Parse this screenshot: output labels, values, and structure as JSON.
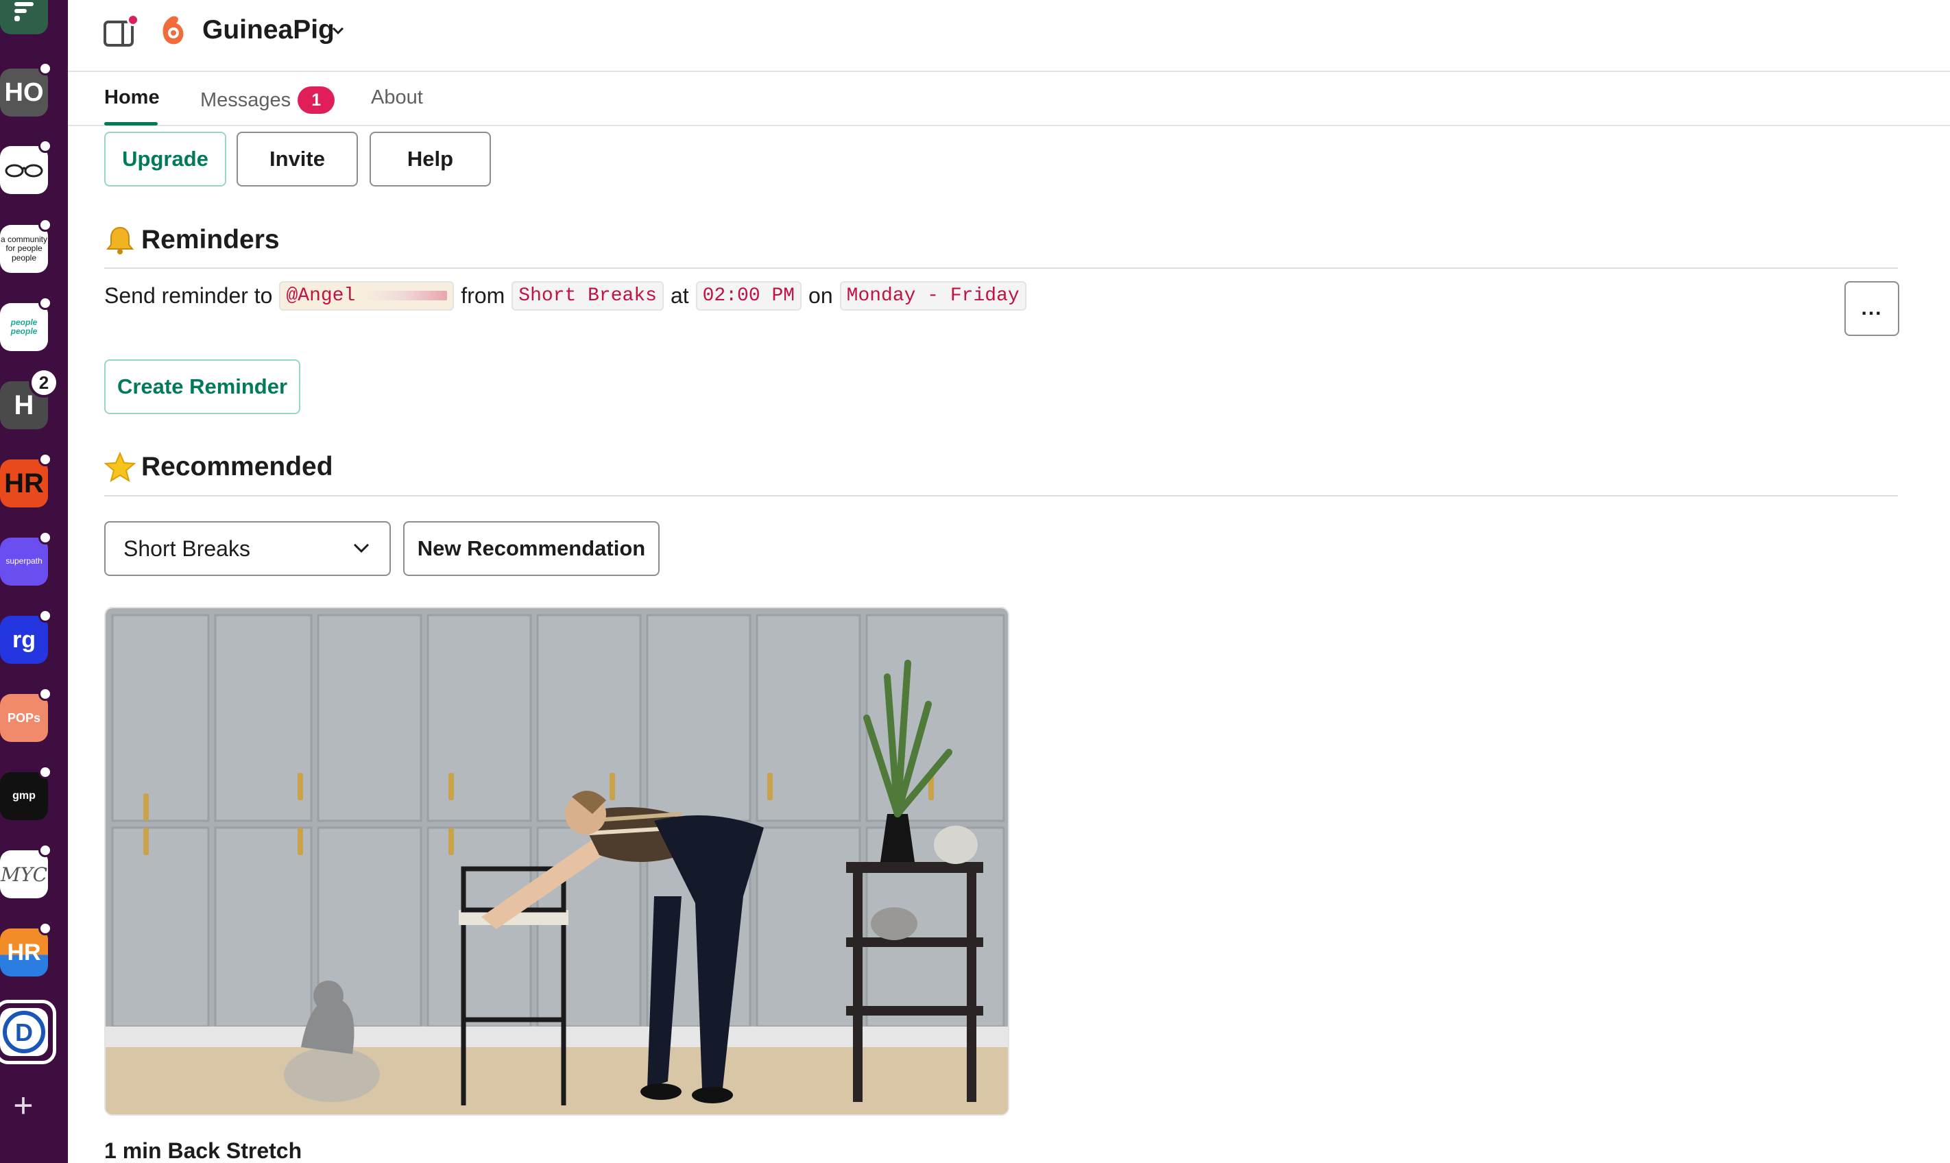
{
  "app": {
    "name": "GuineaPig"
  },
  "workspaces": {
    "items": [
      {
        "label": "",
        "bg": "#2e5f48"
      },
      {
        "label": "HO",
        "bg": "#555555"
      },
      {
        "label": "",
        "bg": "#ffffff"
      },
      {
        "label": "a community for people people",
        "bg": "#ffffff"
      },
      {
        "label": "people people",
        "bg": "#ffffff"
      },
      {
        "label": "H",
        "bg": "#4a4a4a",
        "badge": "2"
      },
      {
        "label": "HR",
        "bg": "#e84a1c"
      },
      {
        "label": "superpath",
        "bg": "#6b4ef0"
      },
      {
        "label": "rg",
        "bg": "#2336e0"
      },
      {
        "label": "POPs",
        "bg": "#f08a6a"
      },
      {
        "label": "gmp",
        "bg": "#111111"
      },
      {
        "label": "MYC",
        "bg": "#ffffff"
      },
      {
        "label": "HR",
        "bg": "#f28c28"
      },
      {
        "label": "D",
        "bg": "#ffffff"
      }
    ]
  },
  "tabs": [
    {
      "label": "Home"
    },
    {
      "label": "Messages",
      "badge": "1"
    },
    {
      "label": "About"
    }
  ],
  "actions": {
    "upgrade": "Upgrade",
    "invite": "Invite",
    "help": "Help"
  },
  "reminders": {
    "heading": "Reminders",
    "icon": "bell-icon",
    "text_1": "Send reminder to",
    "user": "@Angel",
    "text_2": "from",
    "category": "Short Breaks",
    "text_3": "at",
    "time": "02:00 PM",
    "text_4": "on",
    "days": "Monday - Friday",
    "more_label": "...",
    "create_button": "Create Reminder"
  },
  "recommended": {
    "heading": "Recommended",
    "icon": "star-icon",
    "select_value": "Short Breaks",
    "new_button": "New Recommendation",
    "video_title": "1 min Back Stretch"
  },
  "colors": {
    "rail": "#3f0e40",
    "accent": "#007a5a",
    "badge": "#e01e5a",
    "code_text": "#c01343"
  }
}
